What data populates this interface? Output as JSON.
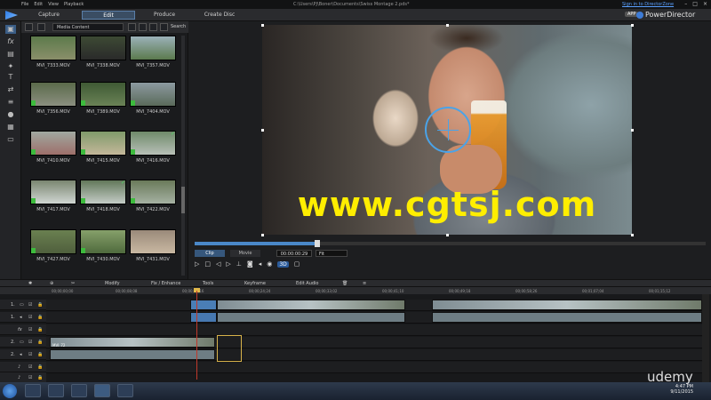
{
  "titlebar": {
    "menu": [
      "File",
      "Edit",
      "View",
      "Playback"
    ],
    "path": "C:\\Users\\PJ\\Boner\\Documents\\Swiss Montage 2.pds*",
    "sign_in": "Sign in to DirectorZone"
  },
  "modes": [
    "Capture",
    "Edit",
    "Produce",
    "Create Disc"
  ],
  "brand": {
    "app_badge": "APP",
    "name": "PowerDirector"
  },
  "library": {
    "filter": "Media Content",
    "search_label": "Search",
    "thumbs": [
      "MVI_7333.MOV",
      "MVI_7338.MOV",
      "MVI_7357.MOV",
      "MVI_7356.MOV",
      "MVI_7389.MOV",
      "MVI_7404.MOV",
      "MVI_7410.MOV",
      "MVI_7415.MOV",
      "MVI_7416.MOV",
      "MVI_7417.MOV",
      "MVI_7418.MOV",
      "MVI_7422.MOV",
      "MVI_7427.MOV",
      "MVI_7430.MOV",
      "MVI_7431.MOV"
    ]
  },
  "preview": {
    "watermark": "www.cgtsj.com",
    "clip_tab": "Clip",
    "movie_tab": "Movie",
    "timecode": "00:00:00:29",
    "fit": "Fit",
    "badge_3d": "3D",
    "seek_progress": 0.24
  },
  "edit_toolbar": {
    "modify": "Modify",
    "fix_enhance": "Fix / Enhance",
    "tools": "Tools",
    "keyframe": "Keyframe",
    "edit_audio": "Edit Audio"
  },
  "timeline": {
    "ruler": [
      "00;00;00;00",
      "00;00;08;08",
      "00;00;16;16",
      "00;00;24;24",
      "00;00;33;02",
      "00;00;41;10",
      "00;00;49;18",
      "00;00;58;26",
      "00;01;07;04",
      "00;01;15;12",
      "00;01;23;20",
      "00;01;31;28"
    ],
    "track_labels": [
      "1.",
      "1.",
      "fx",
      "2.",
      "2.",
      "♪",
      "♪"
    ],
    "clip_label": "MVI_72"
  },
  "taskbar": {
    "time": "4:47 PM",
    "date": "9/11/2015"
  },
  "overlay": {
    "udemy": "udemy"
  }
}
